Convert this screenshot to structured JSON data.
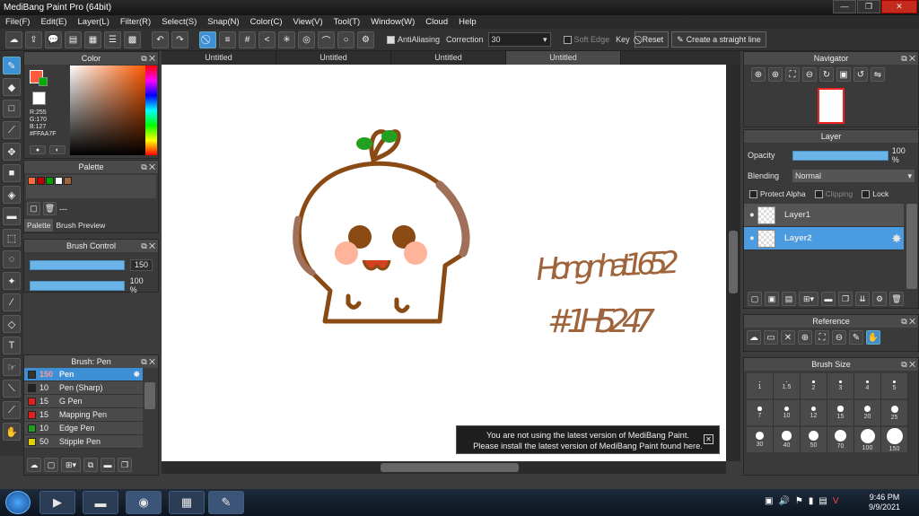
{
  "app": {
    "title": "MediBang Paint Pro (64bit)"
  },
  "menu": [
    "File(F)",
    "Edit(E)",
    "Layer(L)",
    "Filter(R)",
    "Select(S)",
    "Snap(N)",
    "Color(C)",
    "View(V)",
    "Tool(T)",
    "Window(W)",
    "Cloud",
    "Help"
  ],
  "toolbar": {
    "antialias": "AntiAliasing",
    "correction_label": "Correction",
    "correction_value": "30",
    "soft_edge": "Soft Edge",
    "key": "Key",
    "reset": "Reset",
    "straight": "Create a straight line"
  },
  "color": {
    "title": "Color",
    "r": "R:255",
    "g": "G:170",
    "b": "B:127",
    "hex": "#FFAA7F",
    "fg": "#ff5a3c",
    "bg": "#ffffff",
    "green": "#00b000"
  },
  "palette": {
    "title": "Palette",
    "swatches": [
      "#ff6a3c",
      "#c00000",
      "#00a000",
      "#ffffff",
      "#a0643c"
    ],
    "name": "---",
    "tab1": "Palette",
    "tab2": "Brush Preview"
  },
  "brush_control": {
    "title": "Brush Control",
    "size": "150",
    "opacity": "100 %",
    "size_level": 1.0,
    "opacity_level": 1.0
  },
  "brush": {
    "title": "Brush: Pen",
    "items": [
      {
        "size": "150",
        "name": "Pen",
        "color": "#333333"
      },
      {
        "size": "10",
        "name": "Pen (Sharp)",
        "color": "#222222"
      },
      {
        "size": "15",
        "name": "G Pen",
        "color": "#e02020"
      },
      {
        "size": "15",
        "name": "Mapping Pen",
        "color": "#e02020"
      },
      {
        "size": "10",
        "name": "Edge Pen",
        "color": "#20a020"
      },
      {
        "size": "50",
        "name": "Stipple Pen",
        "color": "#e0d000"
      }
    ]
  },
  "tabs": [
    "Untitled",
    "Untitled",
    "Untitled",
    "Untitled"
  ],
  "canvas": {
    "handwriting1": "Hongnhat1652",
    "handwriting2": "#1H5247"
  },
  "notice": {
    "line1": "You are not using the latest version of MediBang Paint.",
    "line2": "Please install the latest version of MediBang Paint found here."
  },
  "navigator": {
    "title": "Navigator"
  },
  "layer": {
    "title": "Layer",
    "opacity_label": "Opacity",
    "opacity_value": "100 %",
    "opacity_level": 1.0,
    "blending_label": "Blending",
    "blending_value": "Normal",
    "protect": "Protect Alpha",
    "clipping": "Clipping",
    "lock": "Lock",
    "layers": [
      "Layer1",
      "Layer2"
    ]
  },
  "reference": {
    "title": "Reference"
  },
  "brush_size": {
    "title": "Brush Size",
    "sizes": [
      "1",
      "1.5",
      "2",
      "3",
      "4",
      "5",
      "7",
      "10",
      "12",
      "15",
      "20",
      "25",
      "30",
      "40",
      "50",
      "70",
      "100",
      "150"
    ]
  },
  "taskbar": {
    "time": "9:46 PM",
    "date": "9/9/2021"
  }
}
